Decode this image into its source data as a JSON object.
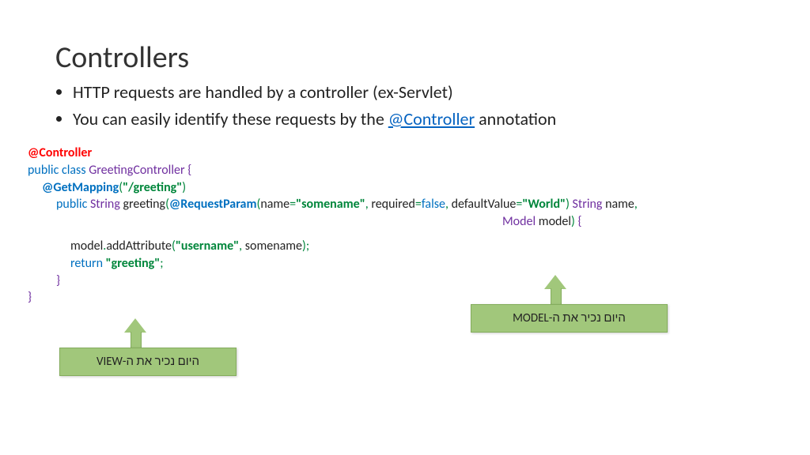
{
  "title": "Controllers",
  "bullets": {
    "b1": "HTTP requests are handled by a controller (ex-Servlet)",
    "b2_pre": "You can easily identify these requests by the ",
    "b2_link": "@Controller",
    "b2_post": " annotation"
  },
  "code": {
    "l1_anno": "@Controller",
    "l2_pub": "public ",
    "l2_class": "class ",
    "l2_name": "GreetingController ",
    "l2_brace": "{",
    "l3_anno": "@GetMapping",
    "l3_p1": "(",
    "l3_str": "\"/greeting\"",
    "l3_p2": ")",
    "l4_pub": "public ",
    "l4_type": "String ",
    "l4_name": "greeting",
    "l4_p1": "(",
    "l4_rp": "@RequestParam",
    "l4_p2": "(",
    "l4_name_k": "name",
    "l4_eq1": "=",
    "l4_name_v": "\"somename\"",
    "l4_c1": ", ",
    "l4_req_k": "required",
    "l4_eq2": "=",
    "l4_req_v": "false",
    "l4_c2": ", ",
    "l4_dv_k": "defaultValue",
    "l4_eq3": "=",
    "l4_dv_v": "\"World\"",
    "l4_p3": ") ",
    "l4_ptype": "String ",
    "l4_pname": "name",
    "l4_c3": ",",
    "l5_mtype": "Model ",
    "l5_mname": "model",
    "l5_p": ") ",
    "l5_brace": "{",
    "l6_m": "model",
    "l6_dot": ".",
    "l6_call": "addAttribute",
    "l6_p1": "(",
    "l6_s1": "\"username\"",
    "l6_c": ", ",
    "l6_arg": "somename",
    "l6_p2": ");",
    "l7_ret": "return ",
    "l7_str": "\"greeting\"",
    "l7_semi": ";",
    "l8": "}",
    "l9": "}"
  },
  "callouts": {
    "view": "היום נכיר את ה-VIEW",
    "model": "היום נכיר את ה-MODEL"
  }
}
